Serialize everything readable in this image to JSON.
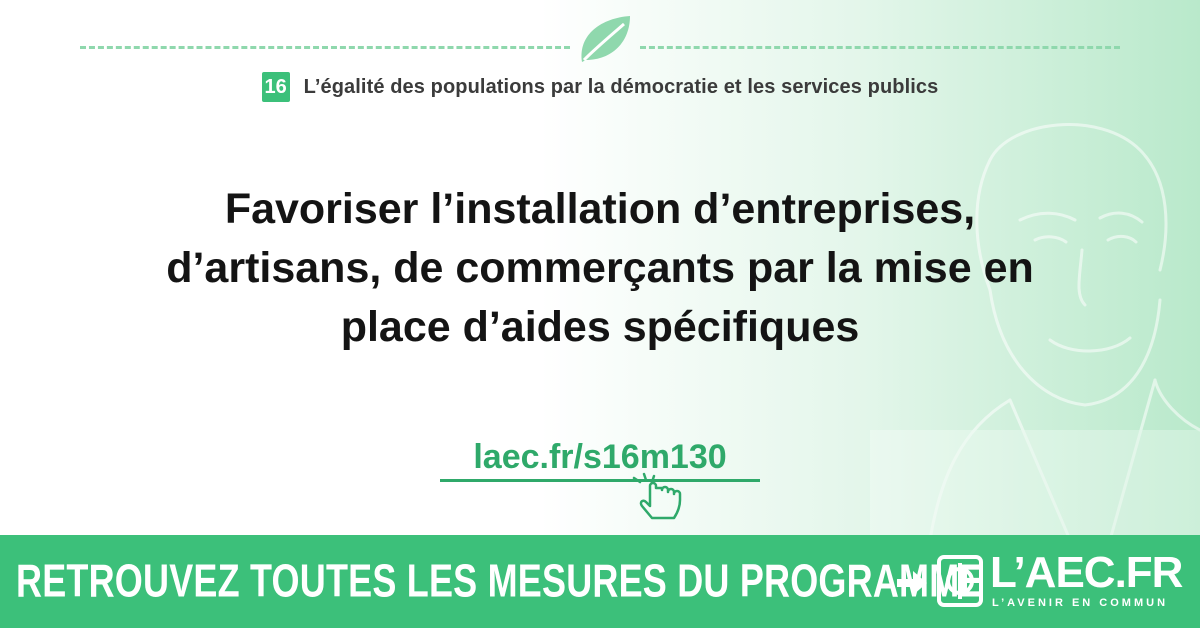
{
  "header": {
    "badge": "16",
    "title": "L’égalité des populations par la démocratie et les services publics"
  },
  "main": {
    "headline_lines": [
      "Favoriser l’installation d’entreprises,",
      "d’artisans, de commerçants par la mise en",
      "place d’aides spécifiques"
    ],
    "link": "laec.fr/s16m130"
  },
  "banner": {
    "cta": "RETROUVEZ TOUTES LES MESURES DU PROGRAMME",
    "logo_name": "L’AEC.FR",
    "logo_tagline": "L’AVENIR EN COMMUN"
  },
  "colors": {
    "accent": "#3cc07a",
    "accent_dark": "#2fa96a",
    "text": "#141414",
    "subtext": "#3b3b3b",
    "dash": "#8fd8ad"
  },
  "icons": [
    "leaf-icon",
    "pointing-hand-icon",
    "arrow-right-icon",
    "phi-logo-icon"
  ]
}
